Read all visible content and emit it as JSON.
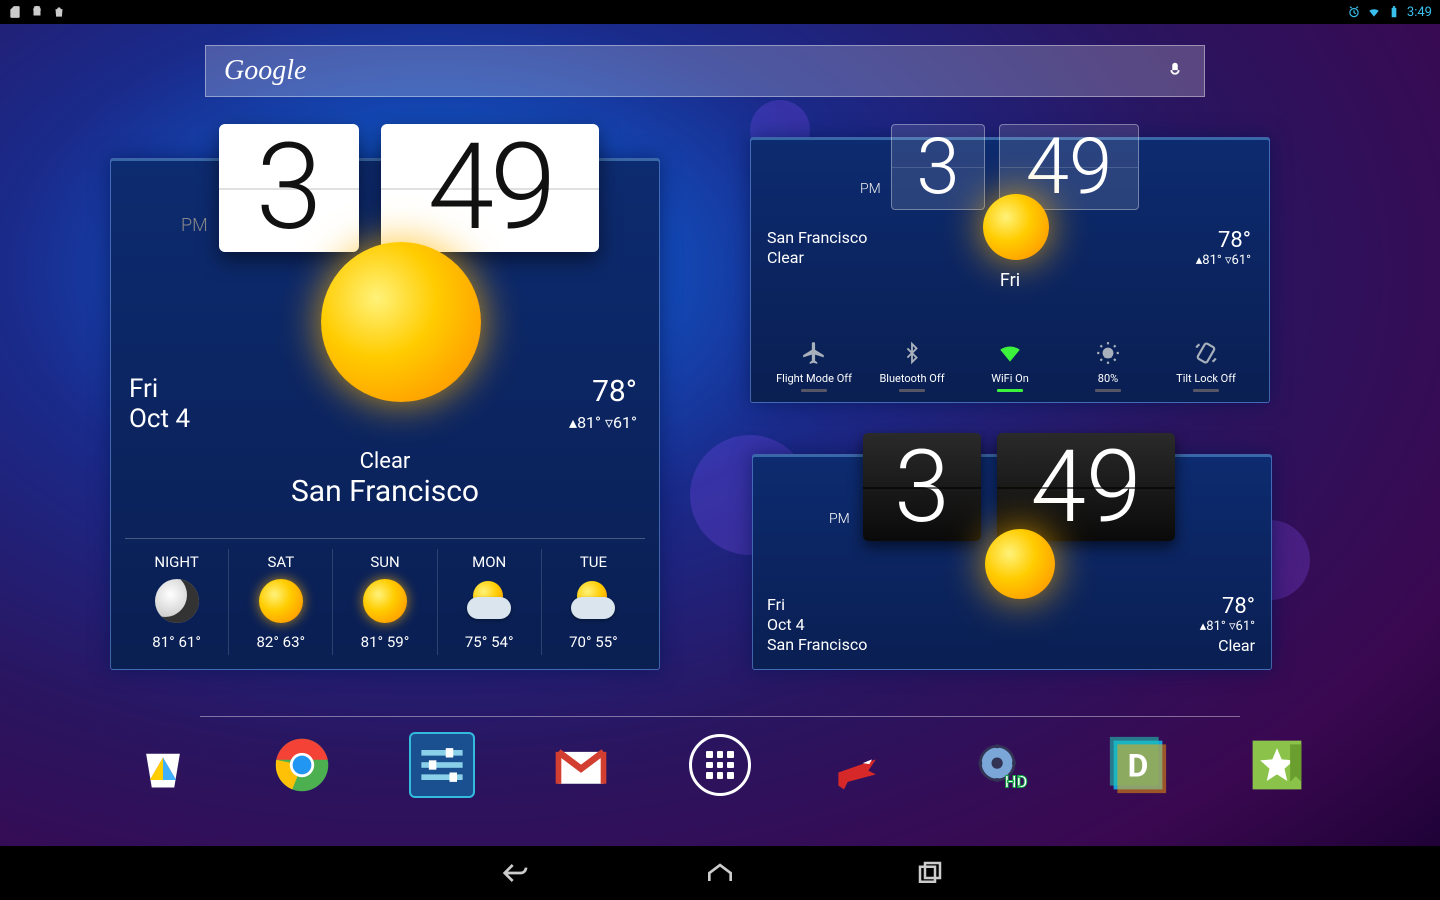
{
  "statusbar": {
    "time": "3:49"
  },
  "search": {
    "logo": "Google"
  },
  "widget_large": {
    "pm": "PM",
    "hour": "3",
    "minute": "49",
    "day": "Fri",
    "date": "Oct 4",
    "temp": "78°",
    "hi": "▴81°",
    "lo": "▿61°",
    "condition": "Clear",
    "city": "San Francisco",
    "forecast": [
      {
        "label": "NIGHT",
        "hi": "81°",
        "lo": "61°",
        "icon": "moon"
      },
      {
        "label": "SAT",
        "hi": "82°",
        "lo": "63°",
        "icon": "sun"
      },
      {
        "label": "SUN",
        "hi": "81°",
        "lo": "59°",
        "icon": "sun"
      },
      {
        "label": "MON",
        "hi": "75°",
        "lo": "54°",
        "icon": "cloudy"
      },
      {
        "label": "TUE",
        "hi": "70°",
        "lo": "55°",
        "icon": "cloudy"
      }
    ]
  },
  "widget_tr": {
    "pm": "PM",
    "hour": "3",
    "minute": "49",
    "city": "San Francisco",
    "condition": "Clear",
    "day": "Fri",
    "temp": "78°",
    "hi": "▴81°",
    "lo": "▿61°",
    "toggles": [
      {
        "label": "Flight Mode Off",
        "icon": "airplane",
        "on": false
      },
      {
        "label": "Bluetooth Off",
        "icon": "bluetooth",
        "on": false
      },
      {
        "label": "WiFi On",
        "icon": "wifi",
        "on": true
      },
      {
        "label": "80%",
        "icon": "brightness",
        "on": false
      },
      {
        "label": "Tilt Lock Off",
        "icon": "rotate",
        "on": false
      }
    ]
  },
  "widget_br": {
    "pm": "PM",
    "hour": "3",
    "minute": "49",
    "day": "Fri",
    "date": "Oct 4",
    "city": "San Francisco",
    "temp": "78°",
    "hi": "▴81°",
    "lo": "▿61°",
    "condition": "Clear"
  },
  "dock": [
    "play-store",
    "chrome",
    "settings",
    "gmail",
    "apps",
    "plane-game",
    "hd-widgets",
    "disqus",
    "star-green"
  ]
}
